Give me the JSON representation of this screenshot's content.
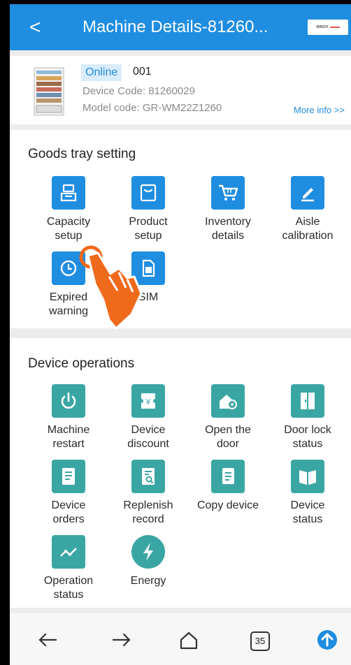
{
  "header": {
    "back_label": "<",
    "title": "Machine Details-81260...",
    "logo_text": "INNOV"
  },
  "device": {
    "status_badge": "Online",
    "number": "001",
    "device_code": "Device Code:  81260029",
    "model_code": "Model code:  GR-WM22Z1260",
    "more_info": "More info >>"
  },
  "goods_tray": {
    "title": "Goods tray setting",
    "items": [
      {
        "line1": "Capacity",
        "line2": "setup",
        "icon": "tray-icon"
      },
      {
        "line1": "Product",
        "line2": "setup",
        "icon": "bag-icon"
      },
      {
        "line1": "Inventory",
        "line2": "details",
        "icon": "cart-icon"
      },
      {
        "line1": "Aisle",
        "line2": "calibration",
        "icon": "pencil-icon"
      },
      {
        "line1": "Expired",
        "line2": "warning",
        "icon": "clock-icon"
      },
      {
        "line1": "SIM",
        "line2": "",
        "icon": "sim-card-icon"
      }
    ]
  },
  "device_ops": {
    "title": "Device operations",
    "items": [
      {
        "line1": "Machine",
        "line2": "restart",
        "icon": "power-icon"
      },
      {
        "line1": "Device",
        "line2": "discount",
        "icon": "discount-ticket-icon"
      },
      {
        "line1": "Open the",
        "line2": "door",
        "icon": "door-key-icon"
      },
      {
        "line1": "Door lock",
        "line2": "status",
        "icon": "door-lock-icon"
      },
      {
        "line1": "Device",
        "line2": "orders",
        "icon": "orders-icon"
      },
      {
        "line1": "Replenish",
        "line2": "record",
        "icon": "record-icon"
      },
      {
        "line1": "Copy device",
        "line2": "",
        "icon": "copy-icon"
      },
      {
        "line1": "Device",
        "line2": "status",
        "icon": "book-icon"
      },
      {
        "line1": "Operation",
        "line2": "status",
        "icon": "trend-icon"
      },
      {
        "line1": "Energy",
        "line2": "",
        "icon": "lightning-icon"
      }
    ]
  },
  "bottom_nav": {
    "tab_count": "35"
  },
  "colors": {
    "primary": "#1f8de0",
    "teal": "#3aa6a4",
    "badge_bg": "#d9ecfb",
    "pointer_hand": "#f06a1c"
  }
}
